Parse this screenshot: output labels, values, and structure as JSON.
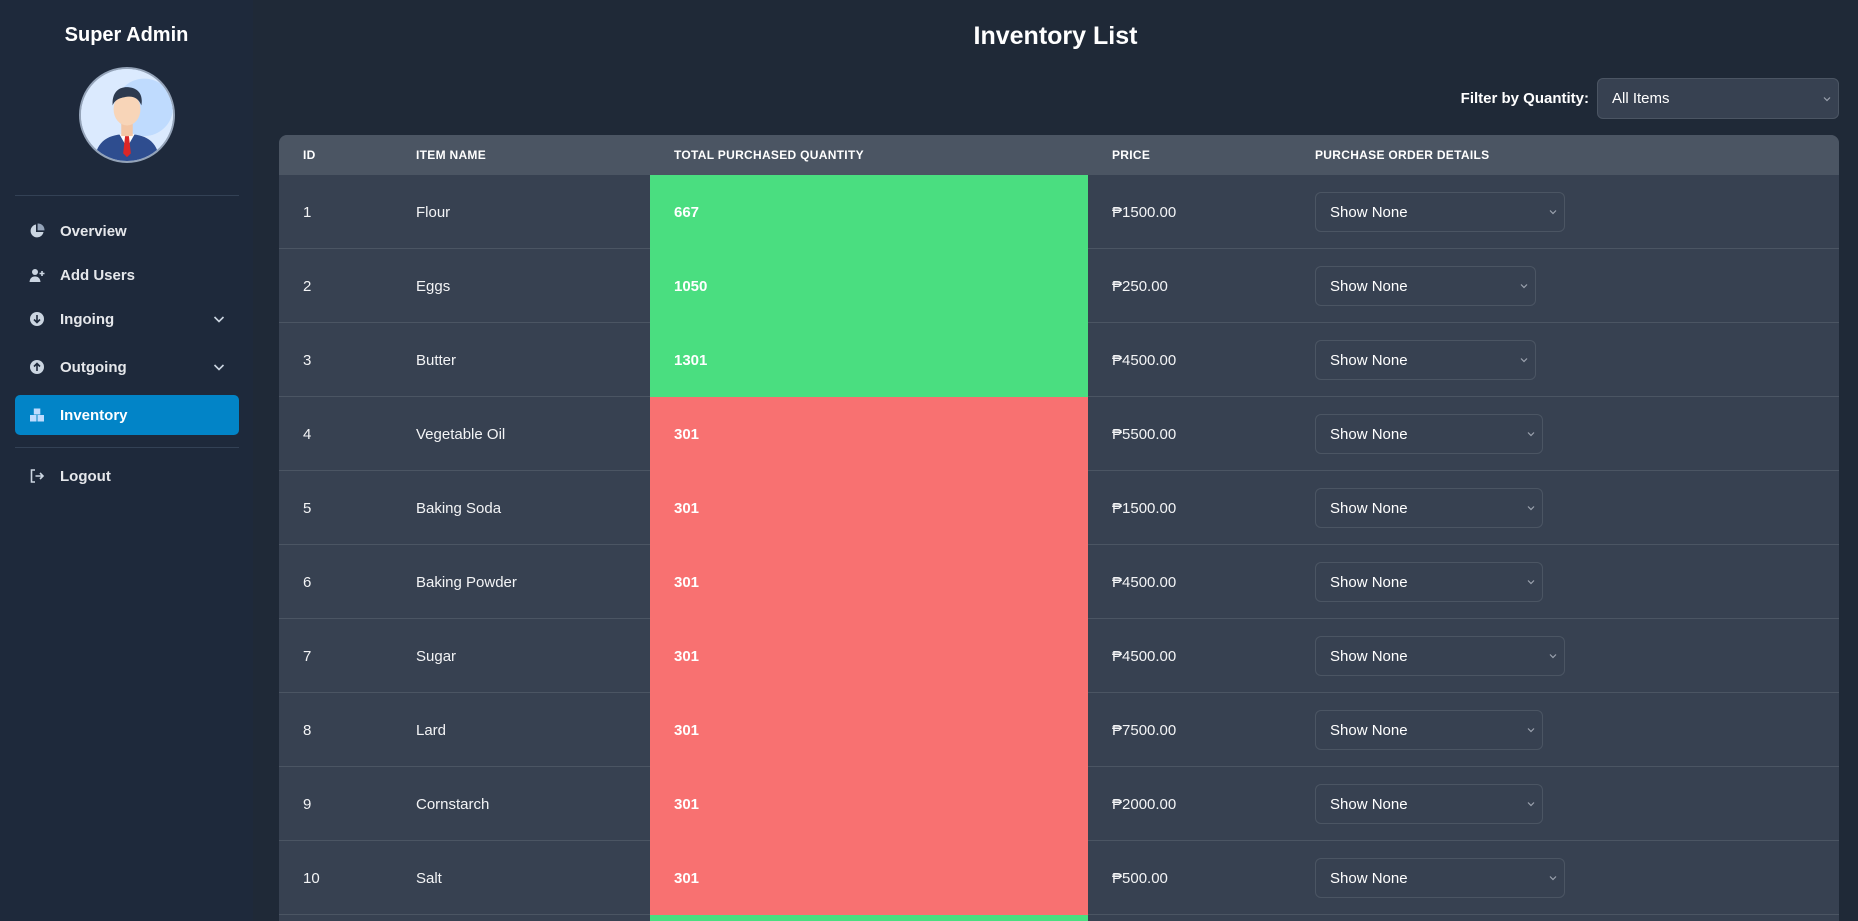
{
  "sidebar": {
    "title": "Super Admin",
    "items": [
      {
        "label": "Overview",
        "icon": "chart-pie-icon"
      },
      {
        "label": "Add Users",
        "icon": "user-plus-icon"
      },
      {
        "label": "Ingoing",
        "icon": "arrow-down-circle-icon"
      },
      {
        "label": "Outgoing",
        "icon": "arrow-up-circle-icon"
      },
      {
        "label": "Inventory",
        "icon": "boxes-icon",
        "active": true
      }
    ],
    "logout": {
      "label": "Logout",
      "icon": "logout-icon"
    }
  },
  "page": {
    "title": "Inventory List",
    "filter_label": "Filter by Quantity:",
    "filter_value": "All Items"
  },
  "table": {
    "columns": [
      "ID",
      "ITEM NAME",
      "TOTAL PURCHASED QUANTITY",
      "PRICE",
      "PURCHASE ORDER DETAILS"
    ],
    "rows": [
      {
        "id": "1",
        "name": "Flour",
        "qty": "667",
        "status": "green",
        "price": "₱1500.00",
        "details": "Show None"
      },
      {
        "id": "2",
        "name": "Eggs",
        "qty": "1050",
        "status": "green",
        "price": "₱250.00",
        "details": "Show None"
      },
      {
        "id": "3",
        "name": "Butter",
        "qty": "1301",
        "status": "green",
        "price": "₱4500.00",
        "details": "Show None"
      },
      {
        "id": "4",
        "name": "Vegetable Oil",
        "qty": "301",
        "status": "red",
        "price": "₱5500.00",
        "details": "Show None"
      },
      {
        "id": "5",
        "name": "Baking Soda",
        "qty": "301",
        "status": "red",
        "price": "₱1500.00",
        "details": "Show None"
      },
      {
        "id": "6",
        "name": "Baking Powder",
        "qty": "301",
        "status": "red",
        "price": "₱4500.00",
        "details": "Show None"
      },
      {
        "id": "7",
        "name": "Sugar",
        "qty": "301",
        "status": "red",
        "price": "₱4500.00",
        "details": "Show None"
      },
      {
        "id": "8",
        "name": "Lard",
        "qty": "301",
        "status": "red",
        "price": "₱7500.00",
        "details": "Show None"
      },
      {
        "id": "9",
        "name": "Cornstarch",
        "qty": "301",
        "status": "red",
        "price": "₱2000.00",
        "details": "Show None"
      },
      {
        "id": "10",
        "name": "Salt",
        "qty": "301",
        "status": "red",
        "price": "₱500.00",
        "details": "Show None"
      }
    ]
  },
  "colors": {
    "background": "#1f2937",
    "sidebar": "#1e293b",
    "accent": "#0284c7",
    "qty_high": "#4ade80",
    "qty_low": "#f87171"
  }
}
